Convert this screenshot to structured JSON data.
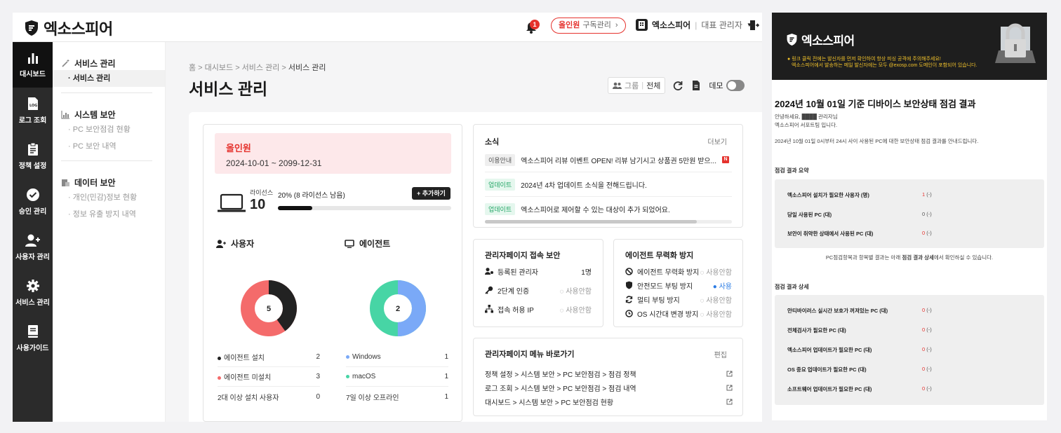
{
  "brand": {
    "name": "엑소스피어"
  },
  "topbar": {
    "notification_count": "1",
    "plan_name": "올인원",
    "plan_manage": "구독관리",
    "org_name": "엑소스피어",
    "separator": "|",
    "role": "대표 관리자"
  },
  "sidebar": {
    "items": [
      {
        "label": "대시보드",
        "icon": "chart-icon"
      },
      {
        "label": "로그 조회",
        "icon": "log-icon"
      },
      {
        "label": "정책 설정",
        "icon": "clipboard-icon"
      },
      {
        "label": "승인 관리",
        "icon": "check-circle-icon"
      },
      {
        "label": "사용자 관리",
        "icon": "add-user-icon"
      },
      {
        "label": "서비스 관리",
        "icon": "gear-icon"
      },
      {
        "label": "사용가이드",
        "icon": "book-icon"
      }
    ]
  },
  "subnav": {
    "groups": [
      {
        "title": "서비스 관리",
        "items": [
          "· 서비스 관리"
        ]
      },
      {
        "title": "시스템 보안",
        "items": [
          "· PC 보안점검 현황",
          "· PC 보안 내역"
        ]
      },
      {
        "title": "데이터 보안",
        "items": [
          "· 개인(민감)정보 현황",
          "· 정보 유출 방지 내역"
        ]
      }
    ]
  },
  "breadcrumb": {
    "path": "홈 > 대시보드 > 서비스 관리 > ",
    "current": "서비스 관리"
  },
  "page": {
    "title": "서비스 관리",
    "group_label": "그룹",
    "group_value": "전체",
    "demo_label": "데모"
  },
  "plan": {
    "name": "올인원",
    "period": "2024-10-01 ~ 2099-12-31",
    "license_label": "라이선스",
    "license_count": "10",
    "usage_text": "20% (8 라이선스 남음)",
    "usage_fraction": 0.2,
    "add_button": "+ 추가하기"
  },
  "users": {
    "title": "사용자",
    "total": "5",
    "installed_fraction": 0.4,
    "colors": {
      "installed": "#222222",
      "not_installed": "#f46b6b"
    },
    "rows": [
      {
        "label": "에이전트 설치",
        "value": "2"
      },
      {
        "label": "에이전트 미설치",
        "value": "3"
      },
      {
        "label": "2대 이상 설치 사용자",
        "value": "0"
      }
    ]
  },
  "agents": {
    "title": "에이전트",
    "total": "2",
    "windows_fraction": 0.5,
    "colors": {
      "windows": "#7aa9f7",
      "macos": "#47d5a5"
    },
    "rows": [
      {
        "label": "Windows",
        "value": "1"
      },
      {
        "label": "macOS",
        "value": "1"
      },
      {
        "label": "7일 이상 오프라인",
        "value": "1"
      }
    ]
  },
  "news": {
    "title": "소식",
    "more": "더보기",
    "items": [
      {
        "tag": "이용안내",
        "text": "엑소스피어 리뷰 이벤트 OPEN! 리뷰 남기시고 상품권 5만원 받으...",
        "badge": "N"
      },
      {
        "tag": "업데이트",
        "text": "2024년 4차 업데이트 소식을 전해드립니다."
      },
      {
        "tag": "업데이트",
        "text": "엑소스피어로 제어할 수 있는 대상이 추가 되었어요."
      }
    ]
  },
  "admin_security": {
    "title": "관리자페이지 접속 보안",
    "rows": [
      {
        "label": "등록된 관리자",
        "value": "1명"
      },
      {
        "label": "2단계 인증",
        "value": "사용안함"
      },
      {
        "label": "접속 허용 IP",
        "value": "사용안함"
      }
    ]
  },
  "agent_protect": {
    "title": "에이전트 무력화 방지",
    "rows": [
      {
        "label": "에이전트 무력화 방지",
        "value": "사용안함"
      },
      {
        "label": "안전모드 부팅 방지",
        "value": "사용"
      },
      {
        "label": "멀티 부팅 방지",
        "value": "사용안함"
      },
      {
        "label": "OS 시간대 변경 방지",
        "value": "사용안함"
      }
    ]
  },
  "shortcuts": {
    "title": "관리자페이지 메뉴 바로가기",
    "edit": "편집",
    "items": [
      "정책 설정 > 시스템 보안 > PC 보안점검 > 점검 정책",
      "로그 조회 > 시스템 보안 > PC 보안점검 > 점검 내역",
      "대시보드 > 시스템 보안 > PC 보안점검 현황"
    ]
  },
  "email": {
    "brand": "엑소스피어",
    "warning_line1": "링크 클릭 전에는 발신자를 먼저 확인하여 항상 피싱 공격에 주의해주세요!",
    "warning_line2": "엑소스피어에서 발송하는 메일 발신자에는 모두 @exosp.com 도메인이 포함되어 있습니다.",
    "title": "2024년 10월 01일 기준 디바이스 보안상태 점검 결과",
    "greeting": "안녕하세요, ████ 관리자님",
    "signature": "엑소스피어 서포트팀 입니다.",
    "intro": "2024년 10월 01일 0시부터 24시 사이 사용된 PC에 대한 보안상태 점검 결과를 안내드립니다.",
    "summary_title": "점검 결과 요약",
    "summary": [
      {
        "label": "엑소스피어 설치가 필요한 사용자 (명)",
        "value": "1",
        "delta": "(-)",
        "red": true
      },
      {
        "label": "당일 사용된 PC (대)",
        "value": "0",
        "delta": "(-)",
        "red": false
      },
      {
        "label": "보안이 취약한 상태에서 사용된 PC (대)",
        "value": "0",
        "delta": "(-)",
        "red": true
      }
    ],
    "note_pre": "PC점검항목과 항목별 결과는 아래 ",
    "note_bold": "점검 결과 상세",
    "note_post": "에서 확인하실 수 있습니다.",
    "detail_title": "점검 결과 상세",
    "details": [
      {
        "label": "안티바이러스 실시간 보호가 꺼져있는 PC (대)",
        "value": "0",
        "delta": "(-)"
      },
      {
        "label": "전체검사가 필요한 PC (대)",
        "value": "0",
        "delta": "(-)"
      },
      {
        "label": "엑소스피어 업데이트가 필요한 PC (대)",
        "value": "0",
        "delta": "(-)"
      },
      {
        "label": "OS 중요 업데이트가 필요한 PC (대)",
        "value": "0",
        "delta": "(-)"
      },
      {
        "label": "소프트웨어 업데이트가 필요한 PC (대)",
        "value": "0",
        "delta": "(-)"
      }
    ]
  }
}
